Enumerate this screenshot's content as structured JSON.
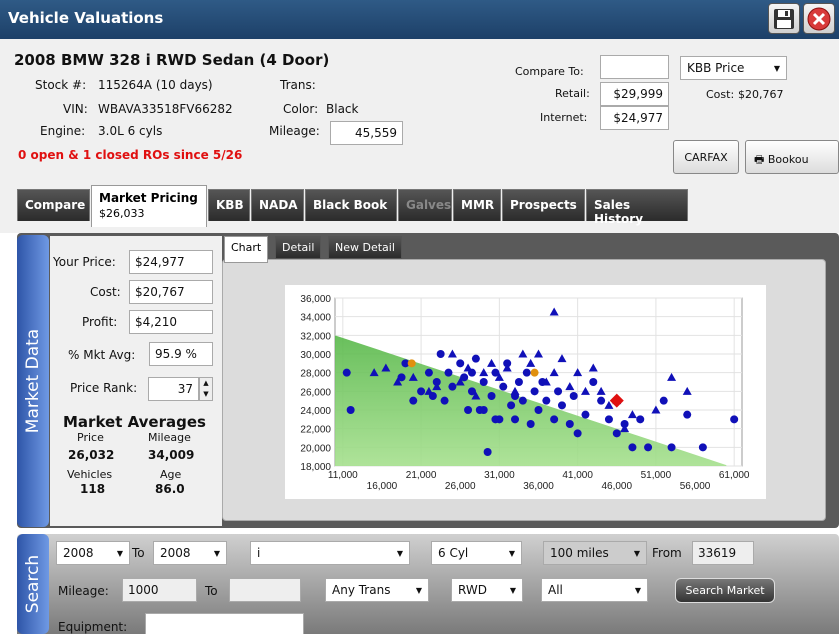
{
  "window": {
    "title": "Vehicle Valuations"
  },
  "vehicle": {
    "title": "2008 BMW 328 i RWD Sedan (4 Door)",
    "stock_label": "Stock #:",
    "stock": "115264A (10 days)",
    "vin_label": "VIN:",
    "vin": "WBAVA33518FV66282",
    "engine_label": "Engine:",
    "engine": "3.0L 6 cyls",
    "trans_label": "Trans:",
    "trans": "",
    "color_label": "Color:",
    "color": "Black",
    "mileage_label": "Mileage:",
    "mileage": "45,559",
    "ro_alert": "0 open & 1 closed ROs since 5/26"
  },
  "pricing": {
    "compare_label": "Compare To:",
    "compare_value": "",
    "retail_label": "Retail:",
    "retail": "$29,999",
    "internet_label": "Internet:",
    "internet": "$24,977",
    "price_source": "KBB Price",
    "cost_label": "Cost:",
    "cost": "$20,767"
  },
  "buttons": {
    "carfax": "CARFAX",
    "bookout": "Bookou"
  },
  "tabs": [
    {
      "label": "Compare"
    },
    {
      "label": "Market Pricing",
      "sub": "$26,033"
    },
    {
      "label": "KBB"
    },
    {
      "label": "NADA"
    },
    {
      "label": "Black Book"
    },
    {
      "label": "Galves"
    },
    {
      "label": "MMR"
    },
    {
      "label": "Prospects"
    },
    {
      "label": "Sales History"
    }
  ],
  "market_data": {
    "section_label": "Market Data",
    "your_price_label": "Your Price:",
    "your_price": "$24,977",
    "cost_label": "Cost:",
    "cost": "$20,767",
    "profit_label": "Profit:",
    "profit": "$4,210",
    "pct_mkt_label": "% Mkt Avg:",
    "pct_mkt": "95.9 %",
    "price_rank_label": "Price Rank:",
    "price_rank": "37",
    "averages_title": "Market Averages",
    "price_label": "Price",
    "price": "26,032",
    "mileage_label": "Mileage",
    "mileage": "34,009",
    "vehicles_label": "Vehicles",
    "vehicles": "118",
    "age_label": "Age",
    "age": "86.0"
  },
  "chart_tabs": [
    "Chart",
    "Detail",
    "New Detail"
  ],
  "chart_data": {
    "type": "scatter",
    "xlim": [
      10000,
      62000
    ],
    "ylim": [
      18000,
      36000
    ],
    "x_ticks_top": [
      "11,000",
      "21,000",
      "31,000",
      "41,000",
      "51,000",
      "61,000"
    ],
    "x_ticks_bottom": [
      "16,000",
      "26,000",
      "36,000",
      "46,000",
      "56,000"
    ],
    "x_top_values": [
      11000,
      21000,
      31000,
      41000,
      51000,
      61000
    ],
    "x_bottom_values": [
      16000,
      26000,
      36000,
      46000,
      56000
    ],
    "y_ticks": [
      "36,000",
      "34,000",
      "32,000",
      "30,000",
      "28,000",
      "26,000",
      "24,000",
      "22,000",
      "20,000",
      "18,000"
    ],
    "y_values": [
      36000,
      34000,
      32000,
      30000,
      28000,
      26000,
      24000,
      22000,
      20000,
      18000
    ],
    "grid": true,
    "trend_band": {
      "x": [
        10000,
        60000
      ],
      "y_top": [
        32000,
        18100
      ]
    },
    "circles": [
      [
        11500,
        28000
      ],
      [
        12000,
        24000
      ],
      [
        18500,
        27500
      ],
      [
        19000,
        29000
      ],
      [
        20000,
        25000
      ],
      [
        21000,
        26000
      ],
      [
        22000,
        28000
      ],
      [
        22500,
        25500
      ],
      [
        23000,
        27000
      ],
      [
        23500,
        30000
      ],
      [
        24000,
        25000
      ],
      [
        24500,
        28000
      ],
      [
        25000,
        26500
      ],
      [
        26000,
        29000
      ],
      [
        26500,
        27500
      ],
      [
        27000,
        24000
      ],
      [
        27500,
        26000
      ],
      [
        28000,
        29500
      ],
      [
        28500,
        24000
      ],
      [
        29000,
        27000
      ],
      [
        29500,
        19500
      ],
      [
        30000,
        25500
      ],
      [
        30500,
        28000
      ],
      [
        31000,
        23000
      ],
      [
        31500,
        26500
      ],
      [
        32000,
        29000
      ],
      [
        32500,
        24500
      ],
      [
        33000,
        23000
      ],
      [
        33500,
        27000
      ],
      [
        34000,
        25000
      ],
      [
        34500,
        28000
      ],
      [
        35000,
        22500
      ],
      [
        35500,
        26000
      ],
      [
        36000,
        24000
      ],
      [
        36500,
        27000
      ],
      [
        37000,
        25000
      ],
      [
        38000,
        23000
      ],
      [
        38500,
        26000
      ],
      [
        39000,
        24500
      ],
      [
        40000,
        22500
      ],
      [
        40500,
        25500
      ],
      [
        41000,
        21500
      ],
      [
        42000,
        23500
      ],
      [
        43000,
        27000
      ],
      [
        44000,
        25000
      ],
      [
        45000,
        23000
      ],
      [
        46000,
        21500
      ],
      [
        47000,
        22500
      ],
      [
        48000,
        20000
      ],
      [
        49000,
        23000
      ],
      [
        50000,
        20000
      ],
      [
        52000,
        25000
      ],
      [
        53000,
        20000
      ],
      [
        55000,
        23500
      ],
      [
        57000,
        20000
      ],
      [
        61000,
        23000
      ],
      [
        30500,
        23000
      ],
      [
        33000,
        25500
      ],
      [
        27500,
        28000
      ],
      [
        29000,
        24000
      ]
    ],
    "triangles": [
      [
        15000,
        28000
      ],
      [
        16500,
        28500
      ],
      [
        18000,
        27000
      ],
      [
        20000,
        27500
      ],
      [
        22000,
        26000
      ],
      [
        23000,
        26500
      ],
      [
        25000,
        30000
      ],
      [
        26000,
        27000
      ],
      [
        27000,
        28500
      ],
      [
        28000,
        25500
      ],
      [
        29000,
        28000
      ],
      [
        30000,
        29000
      ],
      [
        31000,
        27500
      ],
      [
        32000,
        28500
      ],
      [
        33000,
        26000
      ],
      [
        34000,
        30000
      ],
      [
        35000,
        29000
      ],
      [
        36000,
        30000
      ],
      [
        37000,
        27000
      ],
      [
        38000,
        28000
      ],
      [
        39000,
        29500
      ],
      [
        40000,
        26500
      ],
      [
        41000,
        28000
      ],
      [
        42000,
        26000
      ],
      [
        43000,
        28500
      ],
      [
        44000,
        26000
      ],
      [
        45000,
        24500
      ],
      [
        46000,
        25000
      ],
      [
        48000,
        23500
      ],
      [
        51000,
        24000
      ],
      [
        53000,
        27500
      ],
      [
        55000,
        26000
      ],
      [
        38000,
        34500
      ],
      [
        47000,
        22000
      ]
    ],
    "highlights": [
      [
        19800,
        29000
      ],
      [
        35500,
        28000
      ]
    ],
    "subject": [
      46000,
      25000
    ]
  },
  "search": {
    "section_label": "Search",
    "year_from": "2008",
    "to_label": "To",
    "year_to": "2008",
    "model": "i",
    "cylinders": "6 Cyl",
    "radius": "100 miles",
    "from_label": "From",
    "zip": "33619",
    "mileage_label": "Mileage:",
    "mileage_from": "1000",
    "mileage_to_label": "To",
    "mileage_to": "",
    "trans": "Any Trans",
    "drive": "RWD",
    "filter": "All",
    "search_button": "Search Market",
    "equipment_label": "Equipment:",
    "equipment": ""
  },
  "colors": {
    "titlebar": "#1d4068",
    "alert": "#e01010",
    "point": "#1010b8",
    "highlight": "#e09010",
    "subject": "#e01010",
    "band": "#7ccd62"
  }
}
